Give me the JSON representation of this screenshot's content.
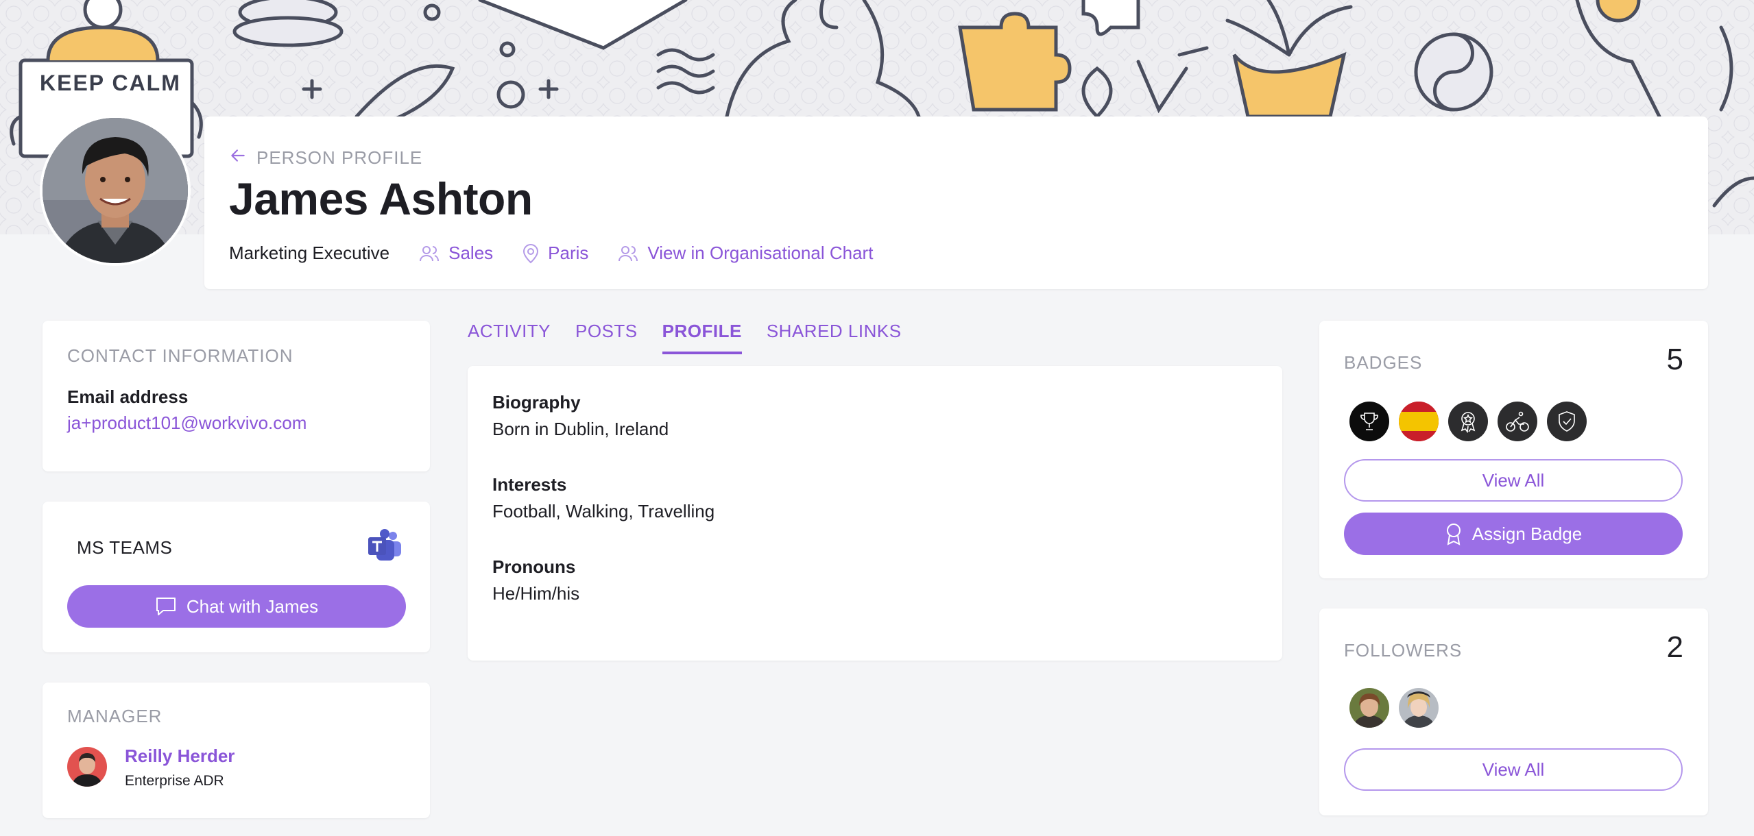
{
  "header": {
    "breadcrumb": "PERSON PROFILE",
    "name": "James Ashton",
    "job_title": "Marketing Executive",
    "department": "Sales",
    "location": "Paris",
    "org_chart_link": "View in Organisational Chart"
  },
  "hero": {
    "poster_text": "KEEP CALM"
  },
  "contact": {
    "title": "CONTACT INFORMATION",
    "email_label": "Email address",
    "email": "ja+product101@workvivo.com"
  },
  "teams": {
    "title": "MS TEAMS",
    "chat_button": "Chat with James"
  },
  "manager": {
    "title": "MANAGER",
    "name": "Reilly Herder",
    "role": "Enterprise ADR"
  },
  "tabs": [
    {
      "label": "ACTIVITY",
      "active": false
    },
    {
      "label": "POSTS",
      "active": false
    },
    {
      "label": "PROFILE",
      "active": true
    },
    {
      "label": "SHARED LINKS",
      "active": false
    }
  ],
  "profile": {
    "biography_label": "Biography",
    "biography": "Born in Dublin, Ireland",
    "interests_label": "Interests",
    "interests": "Football, Walking, Travelling",
    "pronouns_label": "Pronouns",
    "pronouns": "He/Him/his"
  },
  "badges": {
    "title": "BADGES",
    "count": "5",
    "icons": [
      "trophy-icon",
      "spain-flag-icon",
      "award-medal-icon",
      "cyclist-icon",
      "shield-check-icon"
    ],
    "view_all": "View All",
    "assign_button": "Assign Badge"
  },
  "followers": {
    "title": "FOLLOWERS",
    "count": "2",
    "view_all": "View All"
  },
  "colors": {
    "accent": "#8a55d8",
    "button": "#9b6fe6",
    "background": "#f4f5f7"
  }
}
